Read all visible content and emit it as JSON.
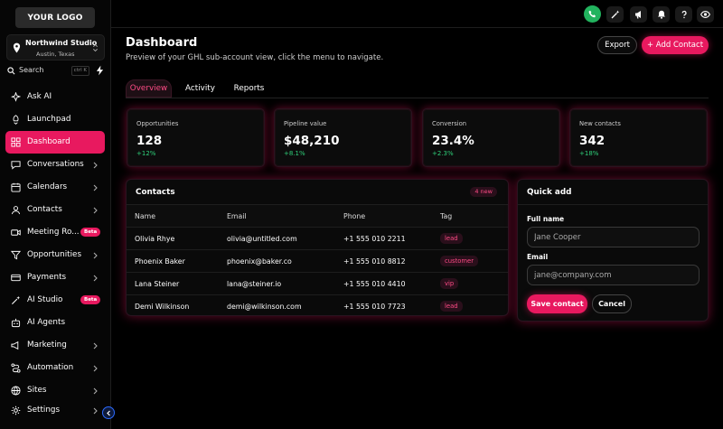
{
  "sidebar": {
    "logo": "YOUR LOGO",
    "account": {
      "name": "Northwind Studio",
      "location": "Austin, Texas"
    },
    "search": {
      "label": "Search",
      "shortcut": "ctrl K"
    },
    "items": [
      {
        "label": "Ask AI",
        "icon": "sparkle-icon"
      },
      {
        "label": "Launchpad",
        "icon": "rocket-icon"
      },
      {
        "label": "Dashboard",
        "icon": "grid-icon",
        "active": true
      },
      {
        "label": "Conversations",
        "icon": "chat-icon"
      },
      {
        "label": "Calendars",
        "icon": "calendar-icon"
      },
      {
        "label": "Contacts",
        "icon": "user-icon"
      },
      {
        "label": "Meeting Ro...",
        "icon": "video-icon",
        "badge": "Beta"
      },
      {
        "label": "Opportunities",
        "icon": "filter-icon"
      },
      {
        "label": "Payments",
        "icon": "card-icon"
      },
      {
        "label": "AI Studio",
        "icon": "wand-icon",
        "badge": "Beta"
      },
      {
        "label": "AI Agents",
        "icon": "bot-icon"
      },
      {
        "label": "Marketing",
        "icon": "megaphone-icon"
      },
      {
        "label": "Automation",
        "icon": "workflow-icon"
      },
      {
        "label": "Sites",
        "icon": "globe-icon"
      }
    ],
    "settings_label": "Settings"
  },
  "header": {
    "title": "Dashboard",
    "subtitle": "Preview of your GHL sub-account view, click the menu to navigate.",
    "export_label": "Export",
    "add_contact_label": "+ Add Contact"
  },
  "tabs": [
    {
      "label": "Overview",
      "active": true
    },
    {
      "label": "Activity"
    },
    {
      "label": "Reports"
    }
  ],
  "stats": [
    {
      "label": "Opportunities",
      "value": "128",
      "delta": "+12%"
    },
    {
      "label": "Pipeline value",
      "value": "$48,210",
      "delta": "+8.1%"
    },
    {
      "label": "Conversion",
      "value": "23.4%",
      "delta": "+2.3%"
    },
    {
      "label": "New contacts",
      "value": "342",
      "delta": "+18%"
    }
  ],
  "contacts": {
    "title": "Contacts",
    "badge": "4 new",
    "columns": [
      "Name",
      "Email",
      "Phone",
      "Tag"
    ],
    "rows": [
      {
        "name": "Olivia Rhye",
        "email": "olivia@untitled.com",
        "phone": "+1 555 010 2211",
        "tag": "lead"
      },
      {
        "name": "Phoenix Baker",
        "email": "phoenix@baker.co",
        "phone": "+1 555 010 8812",
        "tag": "customer"
      },
      {
        "name": "Lana Steiner",
        "email": "lana@steiner.io",
        "phone": "+1 555 010 4410",
        "tag": "vip"
      },
      {
        "name": "Demi Wilkinson",
        "email": "demi@wilkinson.com",
        "phone": "+1 555 010 7723",
        "tag": "lead"
      }
    ]
  },
  "quick_add": {
    "title": "Quick add",
    "name_label": "Full name",
    "name_placeholder": "Jane Cooper",
    "email_label": "Email",
    "email_placeholder": "jane@company.com",
    "save_label": "Save contact",
    "cancel_label": "Cancel"
  },
  "colors": {
    "accent": "#e8195f",
    "positive": "#2fd07a",
    "call": "#22b35e"
  }
}
